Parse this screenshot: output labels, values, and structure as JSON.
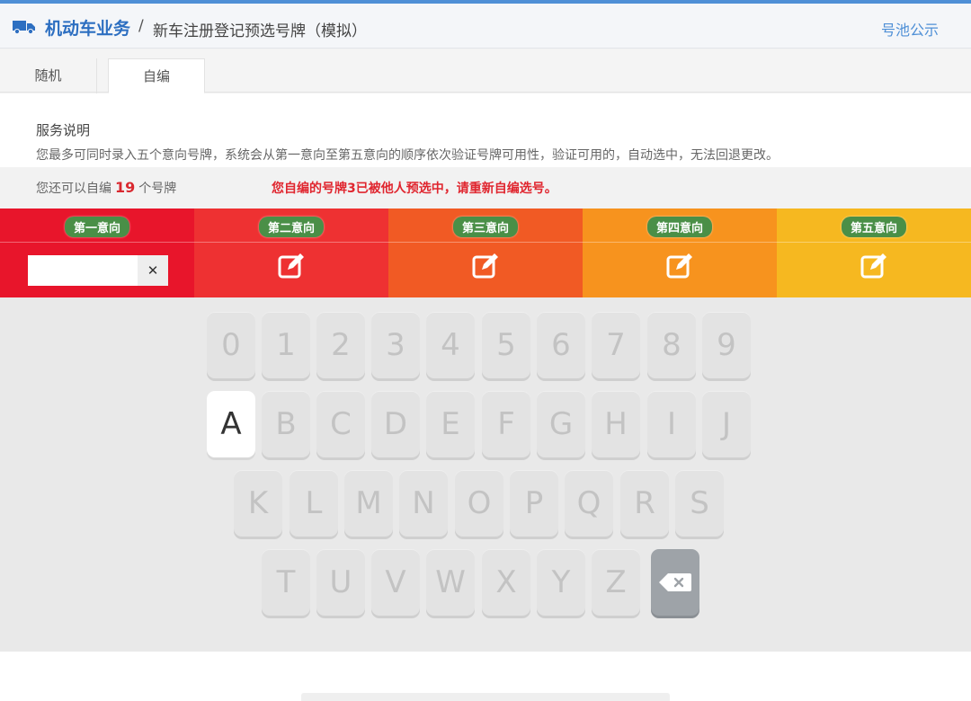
{
  "header": {
    "breadcrumb_main": "机动车业务",
    "breadcrumb_sep": "/",
    "breadcrumb_sub": "新车注册登记预选号牌（模拟）",
    "public_link": "号池公示"
  },
  "tabs": [
    {
      "label": "随机",
      "active": false
    },
    {
      "label": "自编",
      "active": true
    }
  ],
  "service": {
    "title": "服务说明",
    "description": "您最多可同时录入五个意向号牌，系统会从第一意向至第五意向的顺序依次验证号牌可用性，验证可用的，自动选中，无法回退更改。"
  },
  "info": {
    "remain_prefix": "您还可以自编",
    "remain_count": "19",
    "remain_suffix": "个号牌",
    "warning": "您自编的号牌3已被他人预选中，请重新自编选号。"
  },
  "preferences": [
    {
      "label": "第一意向",
      "color": "#e8152b",
      "mode": "input",
      "value": ""
    },
    {
      "label": "第二意向",
      "color": "#ee3132",
      "mode": "edit"
    },
    {
      "label": "第三意向",
      "color": "#f15a24",
      "mode": "edit"
    },
    {
      "label": "第四意向",
      "color": "#f7931e",
      "mode": "edit"
    },
    {
      "label": "第五意向",
      "color": "#f6b820",
      "mode": "edit"
    }
  ],
  "keyboard": {
    "row1": [
      "0",
      "1",
      "2",
      "3",
      "4",
      "5",
      "6",
      "7",
      "8",
      "9"
    ],
    "row2": [
      "A",
      "B",
      "C",
      "D",
      "E",
      "F",
      "G",
      "H",
      "I",
      "J"
    ],
    "row3": [
      "K",
      "L",
      "M",
      "N",
      "O",
      "P",
      "Q",
      "R",
      "S"
    ],
    "row4": [
      "T",
      "U",
      "V",
      "W",
      "X",
      "Y",
      "Z"
    ],
    "active_key": "A",
    "delete_icon": "backspace-icon"
  },
  "icons": {
    "breadcrumb": "truck-icon",
    "edit": "edit-icon",
    "clear": "close-icon"
  }
}
